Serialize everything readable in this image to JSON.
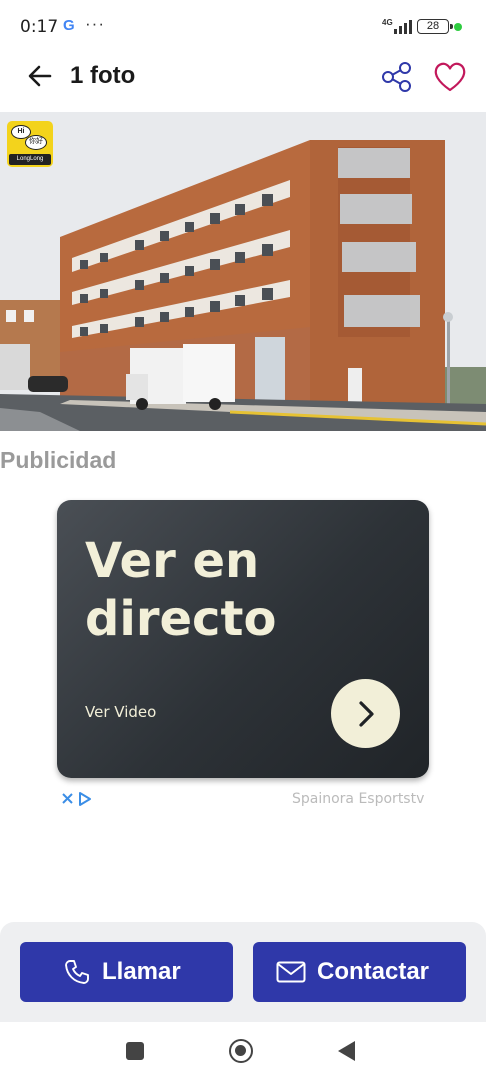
{
  "status_bar": {
    "time": "0:17",
    "google_icon": "G",
    "more_dots": "···",
    "network": "4G",
    "battery": "28"
  },
  "header": {
    "title": "1 foto",
    "back_icon": "arrow-left-icon",
    "share_icon": "share-icon",
    "favorite_icon": "heart-icon"
  },
  "photo": {
    "watermark_label": "LongLong",
    "watermark_icon_1": "Hi",
    "watermark_icon_2": "你好"
  },
  "advertising": {
    "section_label": "Publicidad",
    "headline": "Ver en directo",
    "cta": "Ver Video",
    "advertiser": "Spainora Esportstv",
    "arrow_icon": "chevron-right-icon",
    "ad_choices_icon": "adchoices-icon"
  },
  "actions": {
    "call_label": "Llamar",
    "contact_label": "Contactar",
    "primary_color": "#2f38a9"
  },
  "nav": {
    "recent_icon": "recent-apps-icon",
    "home_icon": "home-icon",
    "back_icon": "back-triangle-icon"
  }
}
